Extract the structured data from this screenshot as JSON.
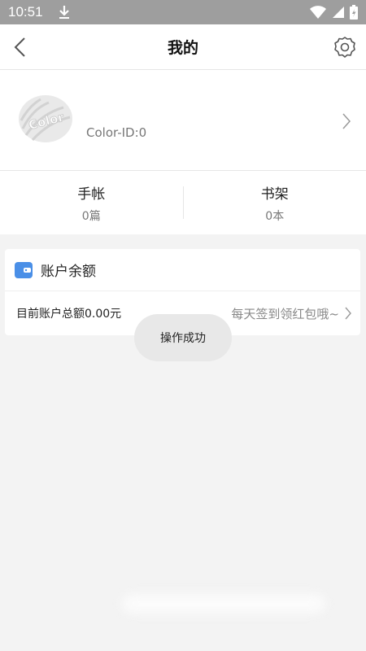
{
  "status_bar": {
    "time": "10:51"
  },
  "header": {
    "title": "我的"
  },
  "profile": {
    "avatar_text": "Color",
    "color_id": "Color-ID:0"
  },
  "stats": [
    {
      "label": "手帐",
      "value": "0篇"
    },
    {
      "label": "书架",
      "value": "0本"
    }
  ],
  "account": {
    "title": "账户余额",
    "balance_text": "目前账户总额0.00元",
    "promo_text": "每天签到领红包哦~"
  },
  "toast": {
    "message": "操作成功"
  },
  "colors": {
    "accent": "#4a8fe7",
    "status_bar": "#9e9e9e",
    "background": "#f3f3f3"
  }
}
